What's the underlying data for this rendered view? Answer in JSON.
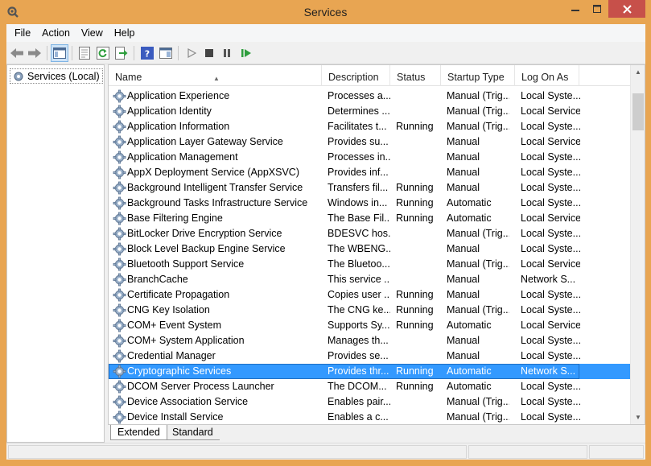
{
  "window": {
    "title": "Services"
  },
  "titlebar_buttons": {
    "minimize": "—",
    "maximize": "☐",
    "close": "✕"
  },
  "menu": [
    "File",
    "Action",
    "View",
    "Help"
  ],
  "toolbar_icons": [
    "back-arrow",
    "forward-arrow",
    "show-hide-console-tree",
    "properties",
    "refresh",
    "export-list",
    "help",
    "show-action-pane",
    "start-service",
    "stop-service",
    "pause-service",
    "restart-service"
  ],
  "tree": {
    "item": "Services (Local)"
  },
  "columns": {
    "name": "Name",
    "description": "Description",
    "status": "Status",
    "startup_type": "Startup Type",
    "log_on_as": "Log On As"
  },
  "services": [
    {
      "name": "Application Experience",
      "description": "Processes a...",
      "status": "",
      "startup_type": "Manual (Trig...",
      "log_on_as": "Local Syste..."
    },
    {
      "name": "Application Identity",
      "description": "Determines ...",
      "status": "",
      "startup_type": "Manual (Trig...",
      "log_on_as": "Local Service"
    },
    {
      "name": "Application Information",
      "description": "Facilitates t...",
      "status": "Running",
      "startup_type": "Manual (Trig...",
      "log_on_as": "Local Syste..."
    },
    {
      "name": "Application Layer Gateway Service",
      "description": "Provides su...",
      "status": "",
      "startup_type": "Manual",
      "log_on_as": "Local Service"
    },
    {
      "name": "Application Management",
      "description": "Processes in...",
      "status": "",
      "startup_type": "Manual",
      "log_on_as": "Local Syste..."
    },
    {
      "name": "AppX Deployment Service (AppXSVC)",
      "description": "Provides inf...",
      "status": "",
      "startup_type": "Manual",
      "log_on_as": "Local Syste..."
    },
    {
      "name": "Background Intelligent Transfer Service",
      "description": "Transfers fil...",
      "status": "Running",
      "startup_type": "Manual",
      "log_on_as": "Local Syste..."
    },
    {
      "name": "Background Tasks Infrastructure Service",
      "description": "Windows in...",
      "status": "Running",
      "startup_type": "Automatic",
      "log_on_as": "Local Syste..."
    },
    {
      "name": "Base Filtering Engine",
      "description": "The Base Fil...",
      "status": "Running",
      "startup_type": "Automatic",
      "log_on_as": "Local Service"
    },
    {
      "name": "BitLocker Drive Encryption Service",
      "description": "BDESVC hos...",
      "status": "",
      "startup_type": "Manual (Trig...",
      "log_on_as": "Local Syste..."
    },
    {
      "name": "Block Level Backup Engine Service",
      "description": "The WBENG...",
      "status": "",
      "startup_type": "Manual",
      "log_on_as": "Local Syste..."
    },
    {
      "name": "Bluetooth Support Service",
      "description": "The Bluetoo...",
      "status": "",
      "startup_type": "Manual (Trig...",
      "log_on_as": "Local Service"
    },
    {
      "name": "BranchCache",
      "description": "This service ...",
      "status": "",
      "startup_type": "Manual",
      "log_on_as": "Network S..."
    },
    {
      "name": "Certificate Propagation",
      "description": "Copies user ...",
      "status": "Running",
      "startup_type": "Manual",
      "log_on_as": "Local Syste..."
    },
    {
      "name": "CNG Key Isolation",
      "description": "The CNG ke...",
      "status": "Running",
      "startup_type": "Manual (Trig...",
      "log_on_as": "Local Syste..."
    },
    {
      "name": "COM+ Event System",
      "description": "Supports Sy...",
      "status": "Running",
      "startup_type": "Automatic",
      "log_on_as": "Local Service"
    },
    {
      "name": "COM+ System Application",
      "description": "Manages th...",
      "status": "",
      "startup_type": "Manual",
      "log_on_as": "Local Syste..."
    },
    {
      "name": "Credential Manager",
      "description": "Provides se...",
      "status": "",
      "startup_type": "Manual",
      "log_on_as": "Local Syste..."
    },
    {
      "name": "Cryptographic Services",
      "description": "Provides thr...",
      "status": "Running",
      "startup_type": "Automatic",
      "log_on_as": "Network S...",
      "selected": true
    },
    {
      "name": "DCOM Server Process Launcher",
      "description": "The DCOM...",
      "status": "Running",
      "startup_type": "Automatic",
      "log_on_as": "Local Syste..."
    },
    {
      "name": "Device Association Service",
      "description": "Enables pair...",
      "status": "",
      "startup_type": "Manual (Trig...",
      "log_on_as": "Local Syste..."
    },
    {
      "name": "Device Install Service",
      "description": "Enables a c...",
      "status": "",
      "startup_type": "Manual (Trig...",
      "log_on_as": "Local Syste..."
    }
  ],
  "tabs": [
    "Extended",
    "Standard"
  ],
  "colors": {
    "frame": "#e8a552",
    "selection": "#3399ff",
    "close": "#c7504a"
  }
}
